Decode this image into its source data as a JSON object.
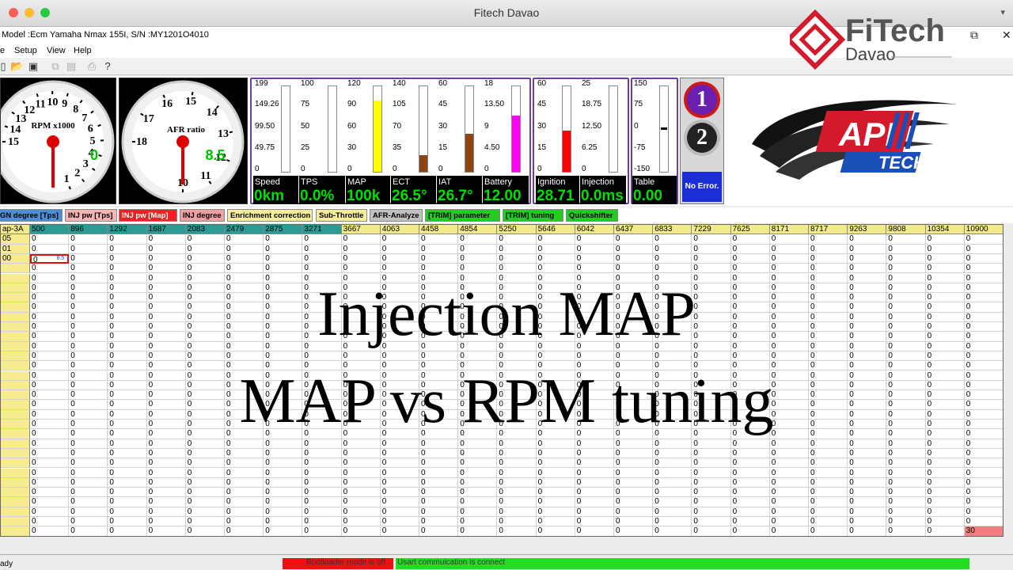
{
  "window": {
    "title": "Fitech Davao"
  },
  "info": "Model :Ecm Yamaha Nmax 155I, S/N :MY1201O4010",
  "menu": [
    "e",
    "Setup",
    "View",
    "Help"
  ],
  "logo": {
    "brand": "FiTech",
    "sub": "Davao",
    "api_top": "API",
    "api_bottom": "TECH"
  },
  "gauges": [
    {
      "label": "RPM x1000",
      "value": "0",
      "ticks": [
        "1",
        "2",
        "3",
        "4",
        "5",
        "6",
        "7",
        "8",
        "9",
        "10",
        "11",
        "12",
        "13",
        "14",
        "15"
      ]
    },
    {
      "label": "AFR ratio",
      "value": "8.5",
      "ticks": [
        "10",
        "11",
        "12",
        "13",
        "14",
        "15",
        "16",
        "17",
        "18"
      ]
    }
  ],
  "bars": [
    {
      "name": "Speed",
      "value": "0km",
      "scale": [
        "199",
        "149.26",
        "99.50",
        "49.75",
        "0"
      ],
      "fill": 0,
      "color": "#ffff00"
    },
    {
      "name": "TPS",
      "value": "0.0%",
      "scale": [
        "100",
        "75",
        "50",
        "25",
        "0"
      ],
      "fill": 0,
      "color": "#ffff00"
    },
    {
      "name": "MAP",
      "value": "100k",
      "scale": [
        "120",
        "90",
        "60",
        "30",
        "0"
      ],
      "fill": 0.83,
      "color": "#ffff00"
    },
    {
      "name": "ECT",
      "value": "26.5°",
      "scale": [
        "140",
        "105",
        "70",
        "35",
        "0"
      ],
      "fill": 0.19,
      "color": "#8b4513"
    },
    {
      "name": "IAT",
      "value": "26.7°",
      "scale": [
        "60",
        "45",
        "30",
        "15",
        "0"
      ],
      "fill": 0.44,
      "color": "#8b4513"
    },
    {
      "name": "Battery",
      "value": "12.00",
      "scale": [
        "18",
        "13.50",
        "9",
        "4.50",
        "0"
      ],
      "fill": 0.66,
      "color": "#ff00ff"
    },
    {
      "name": "Ignition",
      "value": "28.71",
      "scale": [
        "60",
        "45",
        "30",
        "15",
        "0"
      ],
      "fill": 0.48,
      "color": "#ff0000"
    },
    {
      "name": "Injection",
      "value": "0.0ms",
      "scale": [
        "25",
        "18.75",
        "12.50",
        "6.25",
        "0"
      ],
      "fill": 0,
      "color": "#ff0000"
    },
    {
      "name": "Table",
      "value": "0.00",
      "scale": [
        "150",
        "75",
        "0",
        "-75",
        "-150"
      ],
      "fill": 0,
      "color": "#ff0000"
    }
  ],
  "indicators": {
    "one": "1",
    "two": "2",
    "error": "No Error."
  },
  "tabs": [
    {
      "label": "GN degree [Tps]",
      "bg": "#4d8fd6",
      "fg": "#000"
    },
    {
      "label": "INJ pw [Tps]",
      "bg": "#f5b5b5",
      "fg": "#000"
    },
    {
      "label": "INJ pw [Map]",
      "bg": "#ee2222",
      "fg": "#fff"
    },
    {
      "label": "INJ degree",
      "bg": "#f0a0a0",
      "fg": "#000"
    },
    {
      "label": "Enrichment correction",
      "bg": "#f6ee9a",
      "fg": "#000"
    },
    {
      "label": "Sub-Throttle",
      "bg": "#f6ee9a",
      "fg": "#000"
    },
    {
      "label": "AFR-Analyze",
      "bg": "#c0c0c0",
      "fg": "#000"
    },
    {
      "label": "[TRIM] parameter",
      "bg": "#22cc22",
      "fg": "#000"
    },
    {
      "label": "[TRIM] tuning",
      "bg": "#22cc22",
      "fg": "#000"
    },
    {
      "label": "Quickshifter",
      "bg": "#22cc22",
      "fg": "#000"
    }
  ],
  "grid": {
    "corner": "ap-3A",
    "columns": [
      "500",
      "896",
      "1292",
      "1687",
      "2083",
      "2479",
      "2875",
      "3271",
      "3667",
      "4063",
      "4458",
      "4854",
      "5250",
      "5646",
      "6042",
      "6437",
      "6833",
      "7229",
      "7625",
      "8171",
      "8717",
      "9263",
      "9808",
      "10354",
      "10900"
    ],
    "row_labels": [
      "05",
      "01",
      "00"
    ],
    "selected_value": "8.5",
    "last_value": "30",
    "default_value": "0"
  },
  "overlay": {
    "line1": "Injection MAP",
    "line2": "MAP vs RPM tuning"
  },
  "status": {
    "ready": "ady",
    "bootloader": "Bootloader mode is off.",
    "usart": "Usart commuication is connect"
  }
}
